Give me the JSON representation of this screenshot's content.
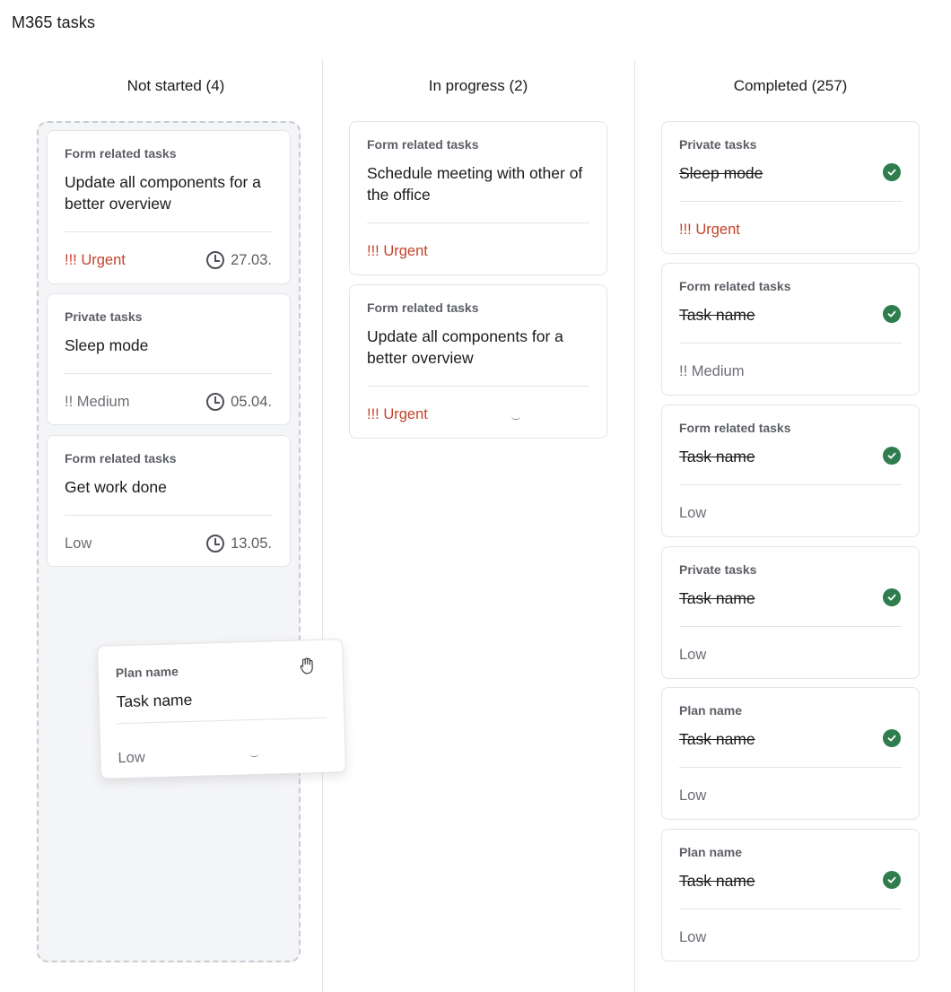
{
  "app": {
    "title": "M365 tasks"
  },
  "columns": {
    "not_started": {
      "label": "Not started (4)"
    },
    "in_progress": {
      "label": "In progress (2)"
    },
    "completed": {
      "label": "Completed (257)"
    }
  },
  "not_started_cards": [
    {
      "plan": "Form related tasks",
      "title": "Update all components for a better overview",
      "priority": "!!! Urgent",
      "due": "27.03."
    },
    {
      "plan": "Private tasks",
      "title": "Sleep mode",
      "priority": "!! Medium",
      "due": "05.04."
    },
    {
      "plan": "Form related tasks",
      "title": "Get work done",
      "priority": "Low",
      "due": "13.05."
    }
  ],
  "dragged_card": {
    "plan": "Plan name",
    "title": "Task name",
    "priority": "Low"
  },
  "in_progress_cards": [
    {
      "plan": "Form related tasks",
      "title": "Schedule meeting with other of the office",
      "priority": "!!! Urgent"
    },
    {
      "plan": "Form related tasks",
      "title": "Update all components for a better overview",
      "priority": "!!! Urgent"
    }
  ],
  "completed_cards": [
    {
      "plan": "Private tasks",
      "title": "Sleep mode",
      "priority": "!!! Urgent"
    },
    {
      "plan": "Form related tasks",
      "title": "Task name",
      "priority": "!! Medium"
    },
    {
      "plan": "Form related tasks",
      "title": "Task name",
      "priority": "Low"
    },
    {
      "plan": "Private tasks",
      "title": "Task name",
      "priority": "Low"
    },
    {
      "plan": "Plan name",
      "title": "Task name",
      "priority": "Low"
    },
    {
      "plan": "Plan name",
      "title": "Task name",
      "priority": "Low"
    }
  ],
  "colors": {
    "urgent": "#c4422b",
    "check": "#2f7d4f",
    "dropzone": "#f4f5f7"
  },
  "icons": {
    "due": "clock-icon",
    "done": "check-circle-icon",
    "drag": "grab-hand-icon"
  }
}
